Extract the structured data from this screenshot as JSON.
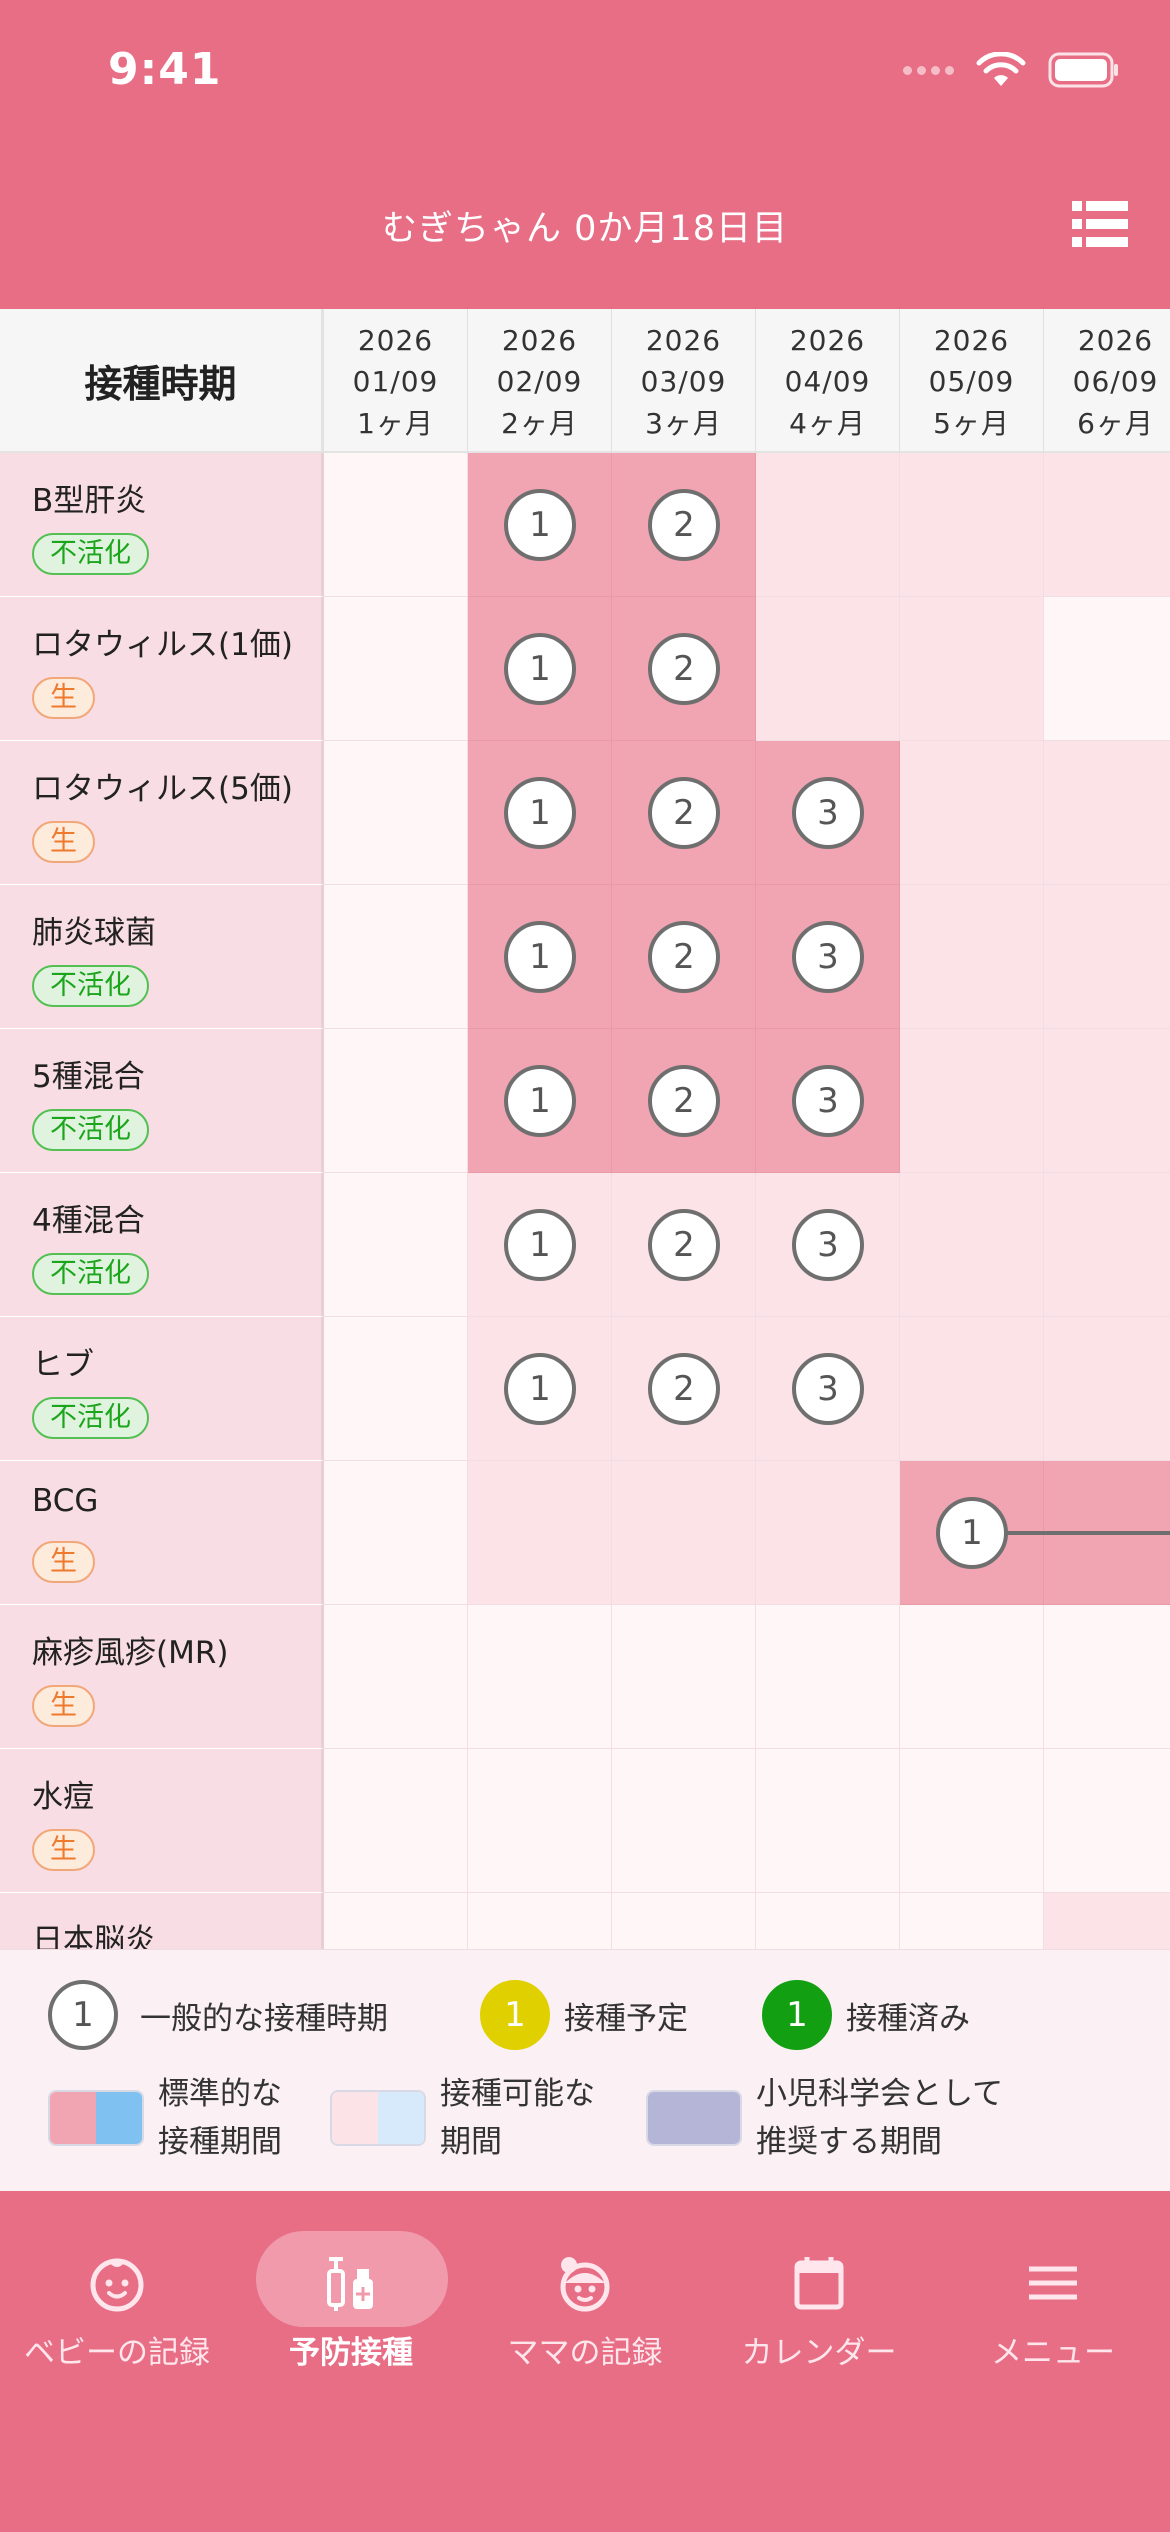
{
  "status_bar": {
    "time": "9:41"
  },
  "header": {
    "title": "むぎちゃん  0か月18日目"
  },
  "grid": {
    "header_label": "接種時期",
    "columns": [
      {
        "year": "2026",
        "date": "01/09",
        "month": "1ヶ月"
      },
      {
        "year": "2026",
        "date": "02/09",
        "month": "2ヶ月"
      },
      {
        "year": "2026",
        "date": "03/09",
        "month": "3ヶ月"
      },
      {
        "year": "2026",
        "date": "04/09",
        "month": "4ヶ月"
      },
      {
        "year": "2026",
        "date": "05/09",
        "month": "5ヶ月"
      },
      {
        "year": "2026",
        "date": "06/09",
        "month": "6ヶ月"
      }
    ],
    "rows": [
      {
        "name": "B型肝炎",
        "type": "不活化",
        "type_kind": "inactivated",
        "cells": [
          "white",
          "dark",
          "dark",
          "light",
          "light",
          "light"
        ],
        "doses": [
          "",
          "1",
          "2",
          "",
          "",
          ""
        ]
      },
      {
        "name": "ロタウィルス(1価)",
        "type": "生",
        "type_kind": "live",
        "cells": [
          "white",
          "dark",
          "dark",
          "light",
          "light",
          "white"
        ],
        "doses": [
          "",
          "1",
          "2",
          "",
          "",
          ""
        ]
      },
      {
        "name": "ロタウィルス(5価)",
        "type": "生",
        "type_kind": "live",
        "cells": [
          "white",
          "dark",
          "dark",
          "dark",
          "light",
          "light"
        ],
        "doses": [
          "",
          "1",
          "2",
          "3",
          "",
          ""
        ]
      },
      {
        "name": "肺炎球菌",
        "type": "不活化",
        "type_kind": "inactivated",
        "cells": [
          "white",
          "dark",
          "dark",
          "dark",
          "light",
          "light"
        ],
        "doses": [
          "",
          "1",
          "2",
          "3",
          "",
          ""
        ]
      },
      {
        "name": "5種混合",
        "type": "不活化",
        "type_kind": "inactivated",
        "cells": [
          "white",
          "dark",
          "dark",
          "dark",
          "light",
          "light"
        ],
        "doses": [
          "",
          "1",
          "2",
          "3",
          "",
          ""
        ]
      },
      {
        "name": "4種混合",
        "type": "不活化",
        "type_kind": "inactivated",
        "cells": [
          "white",
          "light",
          "light",
          "light",
          "light",
          "light"
        ],
        "doses": [
          "",
          "1",
          "2",
          "3",
          "",
          ""
        ]
      },
      {
        "name": "ヒブ",
        "type": "不活化",
        "type_kind": "inactivated",
        "cells": [
          "white",
          "light",
          "light",
          "light",
          "light",
          "light"
        ],
        "doses": [
          "",
          "1",
          "2",
          "3",
          "",
          ""
        ]
      },
      {
        "name": "BCG",
        "type": "生",
        "type_kind": "live",
        "cells": [
          "white",
          "light",
          "light",
          "light",
          "dark",
          "dark"
        ],
        "doses": [
          "",
          "",
          "",
          "",
          "1",
          ""
        ],
        "continues": true
      },
      {
        "name": "麻疹風疹(MR)",
        "type": "生",
        "type_kind": "live",
        "cells": [
          "white",
          "white",
          "white",
          "white",
          "white",
          "white"
        ],
        "doses": [
          "",
          "",
          "",
          "",
          "",
          ""
        ]
      },
      {
        "name": "水痘",
        "type": "生",
        "type_kind": "live",
        "cells": [
          "white",
          "white",
          "white",
          "white",
          "white",
          "white"
        ],
        "doses": [
          "",
          "",
          "",
          "",
          "",
          ""
        ]
      },
      {
        "name": "日本脳炎",
        "type": "",
        "type_kind": "",
        "cells": [
          "white",
          "white",
          "white",
          "white",
          "white",
          "light"
        ],
        "doses": [
          "",
          "",
          "",
          "",
          "",
          ""
        ]
      }
    ]
  },
  "legend": {
    "general": {
      "symbol": "1",
      "label": "一般的な接種時期"
    },
    "planned": {
      "symbol": "1",
      "label": "接種予定"
    },
    "done": {
      "symbol": "1",
      "label": "接種済み"
    },
    "standard_line1": "標準的な",
    "standard_line2": "接種期間",
    "possible_line1": "接種可能な",
    "possible_line2": "期間",
    "recommended_line1": "小児科学会として",
    "recommended_line2": "推奨する期間"
  },
  "tabs": [
    {
      "label": "ベビーの記録",
      "icon": "baby-face-icon",
      "active": false
    },
    {
      "label": "予防接種",
      "icon": "vaccine-icon",
      "active": true
    },
    {
      "label": "ママの記録",
      "icon": "mama-face-icon",
      "active": false
    },
    {
      "label": "カレンダー",
      "icon": "calendar-icon",
      "active": false
    },
    {
      "label": "メニュー",
      "icon": "menu-icon",
      "active": false
    }
  ],
  "colors": {
    "brand": "#e86e86",
    "standard_period": "#f1a4b2",
    "possible_period": "#fbe3e7",
    "planned": "#e1d000",
    "done": "#12a012",
    "recommended": "#b5b5d8"
  }
}
